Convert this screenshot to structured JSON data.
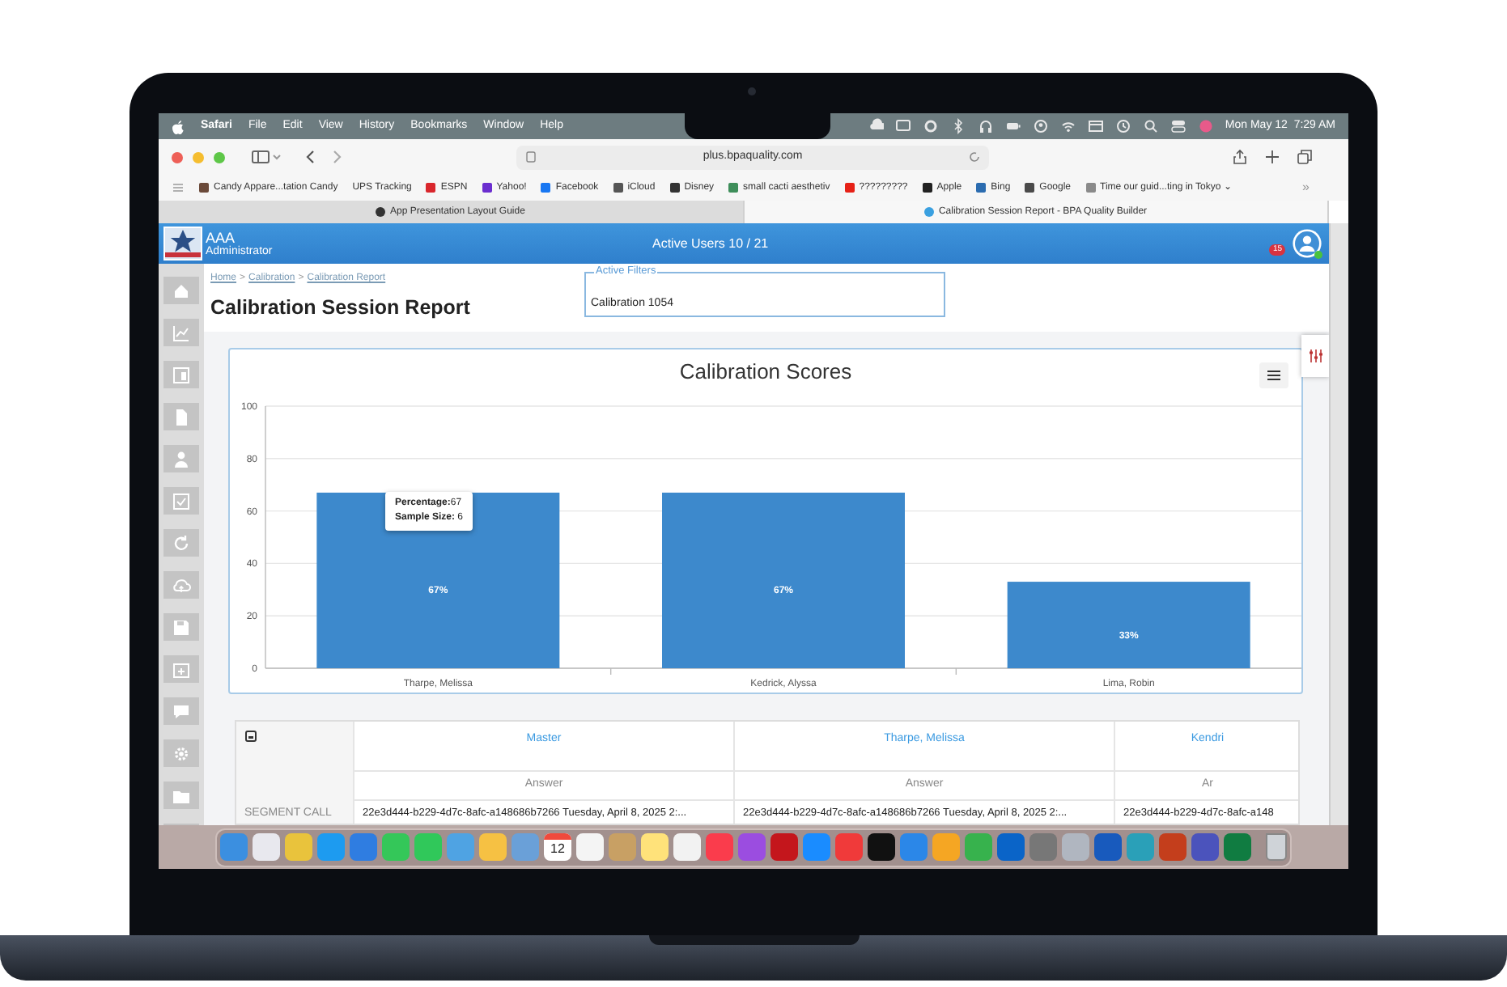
{
  "menu_bar": {
    "app": "Safari",
    "menus": [
      "File",
      "Edit",
      "View",
      "History",
      "Bookmarks",
      "Window",
      "Help"
    ],
    "clock": "Mon May 12  7:29 AM"
  },
  "browser": {
    "address": "plus.bpaquality.com",
    "bookmarks": [
      {
        "label": "Candy Appare...tation Candy",
        "color": "#6b4a3a"
      },
      {
        "label": "UPS Tracking"
      },
      {
        "label": "ESPN",
        "color": "#d9262c"
      },
      {
        "label": "Yahoo!",
        "color": "#6b2ecf"
      },
      {
        "label": "Facebook",
        "color": "#1877f2"
      },
      {
        "label": "iCloud",
        "color": "#555555"
      },
      {
        "label": "Disney",
        "color": "#333333"
      },
      {
        "label": "small cacti aesthetiv",
        "color": "#3e8e5a"
      },
      {
        "label": "?????????",
        "color": "#e62117"
      },
      {
        "label": "Apple",
        "color": "#222222"
      },
      {
        "label": "Bing",
        "color": "#2b6cb0"
      },
      {
        "label": "Google",
        "color": "#4a4a4a"
      },
      {
        "label": "Time our guid...ting in Tokyo ⌄",
        "color": "#8a8a8a"
      }
    ],
    "more_bookmarks": "»",
    "tabs": [
      {
        "label": "App Presentation Layout Guide",
        "selected": false
      },
      {
        "label": "Calibration Session Report - BPA Quality Builder",
        "selected": true
      }
    ]
  },
  "app": {
    "header": {
      "org": "AAA",
      "role": "Administrator",
      "active_users": "Active Users 10 / 21",
      "notification_count": "15"
    },
    "breadcrumb": {
      "items": [
        "Home",
        "Calibration",
        "Calibration Report"
      ],
      "separator": ">"
    },
    "page_title": "Calibration Session Report",
    "active_filters": {
      "legend": "Active Filters",
      "value": "Calibration 1054"
    },
    "chart": {
      "title": "Calibration Scores",
      "chart_data": {
        "type": "bar",
        "categories": [
          "Tharpe, Melissa",
          "Kedrick, Alyssa",
          "Lima, Robin"
        ],
        "values": [
          67,
          67,
          33
        ],
        "ylim": [
          0,
          100
        ],
        "grid": true,
        "yticks": [
          0,
          20,
          40,
          60,
          80,
          100
        ],
        "value_labels": [
          "67%",
          "67%",
          "33%"
        ]
      },
      "tooltip": {
        "lines": [
          "**Percentage:**67",
          "**Sample Size:** 6"
        ]
      }
    },
    "table": {
      "columns": [
        "Master",
        "Tharpe, Melissa",
        "Kendri"
      ],
      "subheaders": [
        "Answer",
        "Answer",
        "Ar"
      ],
      "rows": [
        {
          "label": "SEGMENT CALL",
          "cells": [
            "22e3d444-b229-4d7c-8afc-a148686b7266 Tuesday, April 8, 2025 2:...",
            "22e3d444-b229-4d7c-8afc-a148686b7266 Tuesday, April 8, 2025 2:...",
            "22e3d444-b229-4d7c-8afc-a148"
          ]
        }
      ]
    }
  },
  "dock": [
    {
      "kind": "app",
      "color": "#3b8fe0"
    },
    {
      "kind": "app",
      "color": "#e8e8ee"
    },
    {
      "kind": "app",
      "color": "#e9c33c"
    },
    {
      "kind": "app",
      "color": "#1d9bf0"
    },
    {
      "kind": "app",
      "color": "#2f7de1"
    },
    {
      "kind": "app",
      "color": "#34c759"
    },
    {
      "kind": "app",
      "color": "#30c85a"
    },
    {
      "kind": "app",
      "color": "#4fa3e3"
    },
    {
      "kind": "app",
      "color": "#f6c143"
    },
    {
      "kind": "app",
      "color": "#6aa0d8"
    },
    {
      "kind": "calendar",
      "color": "#ffffff",
      "label": "12"
    },
    {
      "kind": "app",
      "color": "#f4f4f4"
    },
    {
      "kind": "app",
      "color": "#c8a064"
    },
    {
      "kind": "app",
      "color": "#ffe27a"
    },
    {
      "kind": "app",
      "color": "#f2f2f2"
    },
    {
      "kind": "app",
      "color": "#fa3c4c"
    },
    {
      "kind": "app",
      "color": "#9b4de0"
    },
    {
      "kind": "app",
      "color": "#c4161c"
    },
    {
      "kind": "app",
      "color": "#1a8cff"
    },
    {
      "kind": "app",
      "color": "#f03a3a"
    },
    {
      "kind": "app",
      "color": "#111111"
    },
    {
      "kind": "app",
      "color": "#2b87e8"
    },
    {
      "kind": "app",
      "color": "#f5a623"
    },
    {
      "kind": "app",
      "color": "#37b24d"
    },
    {
      "kind": "app",
      "color": "#0a64c8"
    },
    {
      "kind": "app",
      "color": "#777777"
    },
    {
      "kind": "app",
      "color": "#b0b6c0"
    },
    {
      "kind": "app",
      "color": "#185abd"
    },
    {
      "kind": "app",
      "color": "#2aa0b8"
    },
    {
      "kind": "app",
      "color": "#c43e1c"
    },
    {
      "kind": "app",
      "color": "#4b53bc"
    },
    {
      "kind": "app",
      "color": "#107c41"
    },
    {
      "kind": "trash",
      "color": "#cfd3d8"
    }
  ]
}
